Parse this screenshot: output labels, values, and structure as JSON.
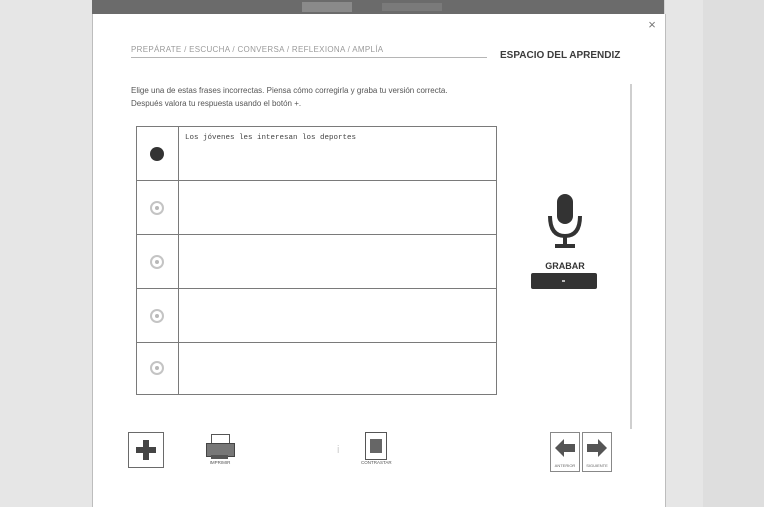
{
  "window": {
    "close_symbol": "×"
  },
  "breadcrumb": "PREPÁRATE / ESCUCHA / CONVERSA / REFLEXIONA / AMPLÍA",
  "section_title": "ESPACIO DEL APRENDIZ",
  "instructions": "Elige una de estas frases incorrectas. Piensa cómo corregirla y graba tu versión correcta. Después valora tu respuesta usando el botón +.",
  "phrases": [
    {
      "text": "Los jóvenes les interesan los deportes",
      "active": true
    },
    {
      "text": "",
      "active": false
    },
    {
      "text": "",
      "active": false
    },
    {
      "text": "",
      "active": false
    },
    {
      "text": "",
      "active": false
    }
  ],
  "recorder": {
    "label": "GRABAR",
    "icon": "microphone-icon"
  },
  "toolbar": {
    "plus_icon": "plus-icon",
    "print_label": "IMPRIMIR",
    "contrast_label": "CONTRASTAR",
    "prev_label": "ANTERIOR",
    "next_label": "SIGUIENTE"
  },
  "colors": {
    "dark": "#333333",
    "border": "#7a7a7a",
    "text_muted": "#9a9a9a"
  }
}
